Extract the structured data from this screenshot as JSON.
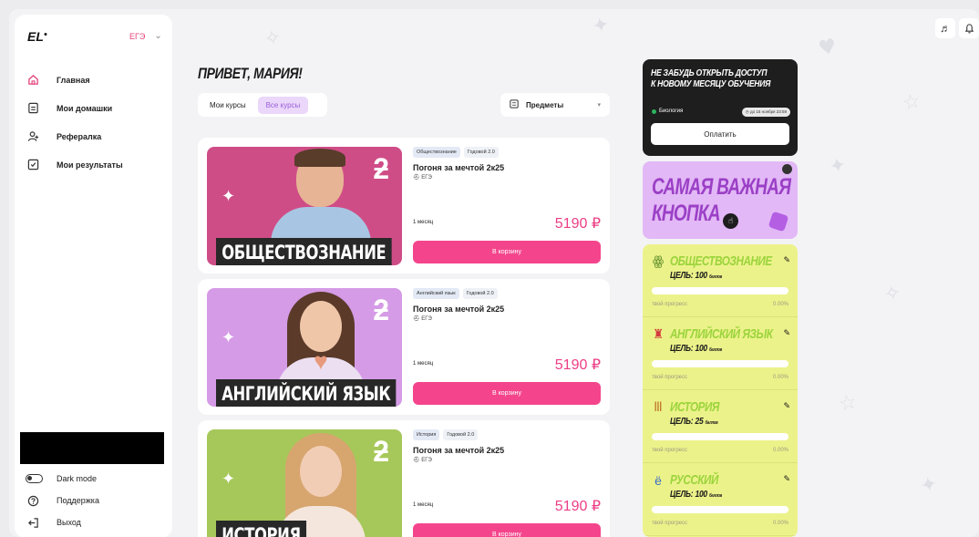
{
  "app": {
    "logo": "EL",
    "exam_selector": "ЕГЭ"
  },
  "sidebar": {
    "items": [
      {
        "label": "Главная",
        "icon": "home-icon",
        "active": true
      },
      {
        "label": "Мои домашки",
        "icon": "homework-icon"
      },
      {
        "label": "Рефералка",
        "icon": "referral-icon"
      },
      {
        "label": "Мои результаты",
        "icon": "results-icon"
      }
    ],
    "bottom": {
      "dark_mode": "Dark mode",
      "support": "Поддержка",
      "logout": "Выход"
    }
  },
  "header": {
    "greeting": "ПРИВЕТ, МАРИЯ!",
    "tabs": [
      {
        "label": "Мои курсы"
      },
      {
        "label": "Все курсы",
        "active": true
      }
    ],
    "subjects_filter": "Предметы"
  },
  "courses": [
    {
      "image_label": "ОБЩЕСТВОЗНАНИЕ",
      "tags": [
        "Обществознание",
        "Годовой 2.0"
      ],
      "name": "Погоня за мечтой 2к25",
      "exam": "ЕГЭ",
      "duration": "1 месяц",
      "price": "5190 ₽",
      "button": "В корзину",
      "bg": "#cf4d87",
      "person": "#a8c6e3"
    },
    {
      "image_label": "АНГЛИЙСКИЙ ЯЗЫК",
      "tags": [
        "Английский язык",
        "Годовой 2.0"
      ],
      "name": "Погоня за мечтой 2к25",
      "exam": "ЕГЭ",
      "duration": "1 месяц",
      "price": "5190 ₽",
      "button": "В корзину",
      "bg": "#d59be6",
      "person": "#e8dcef"
    },
    {
      "image_label": "ИСТОРИЯ",
      "tags": [
        "История",
        "Годовой 2.0"
      ],
      "name": "Погоня за мечтой 2к25",
      "exam": "ЕГЭ",
      "duration": "1 месяц",
      "price": "5190 ₽",
      "button": "В корзину",
      "bg": "#a6c85a",
      "person": "#f1ddd0"
    }
  ],
  "promo": {
    "title_line1": "НЕ ЗАБУДЬ ОТКРЫТЬ ДОСТУП",
    "title_line2": "К НОВОМУ МЕСЯЦУ ОБУЧЕНИЯ",
    "subject": "Биология",
    "deadline": "до 15 ноября 23:59",
    "pay_button": "Оплатить"
  },
  "important_button": {
    "line1": "САМАЯ ВАЖНАЯ",
    "line2": "КНОПКА"
  },
  "goals": [
    {
      "subject": "ОБЩЕСТВОЗНАНИЕ",
      "icon": "people-icon",
      "target": "ЦЕЛЬ: 100",
      "unit": "баллов",
      "progress_label": "твой прогресс",
      "progress": "0.00%"
    },
    {
      "subject": "АНГЛИЙСКИЙ ЯЗЫК",
      "icon": "bigben-icon",
      "target": "ЦЕЛЬ: 100",
      "unit": "баллов",
      "progress_label": "твой прогресс",
      "progress": "0.00%"
    },
    {
      "subject": "ИСТОРИЯ",
      "icon": "column-icon",
      "target": "ЦЕЛЬ: 25",
      "unit": "баллов",
      "progress_label": "твой прогресс",
      "progress": "0.00%"
    },
    {
      "subject": "РУССКИЙ",
      "icon": "letter-yo-icon",
      "target": "ЦЕЛЬ: 100",
      "unit": "баллов",
      "progress_label": "твой прогресс",
      "progress": "0.00%"
    }
  ],
  "colors": {
    "accent": "#f4458c",
    "price": "#ec3e86",
    "goal_panel": "#ecf28a",
    "important_panel": "#e2b8f6"
  }
}
